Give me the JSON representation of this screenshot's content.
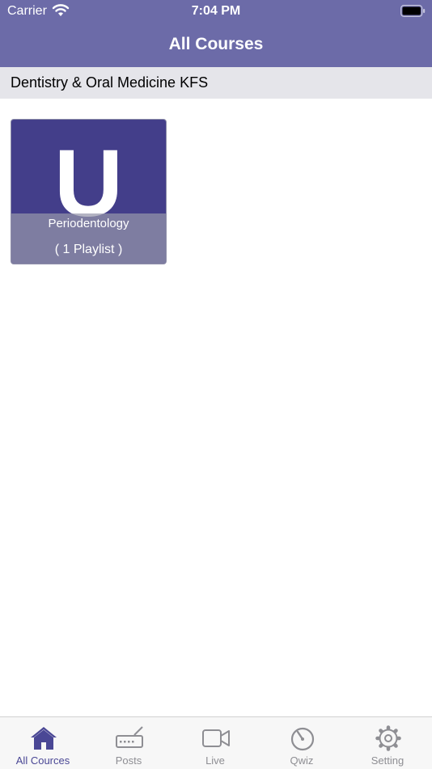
{
  "status_bar": {
    "carrier": "Carrier",
    "time": "7:04 PM"
  },
  "nav": {
    "title": "All Courses"
  },
  "section": {
    "title": "Dentistry & Oral Medicine KFS"
  },
  "courses": [
    {
      "letter": "U",
      "name": "Periodentology",
      "playlists": "( 1 Playlist )"
    }
  ],
  "tabs": [
    {
      "label": "All Cources",
      "icon": "home-icon",
      "active": true
    },
    {
      "label": "Posts",
      "icon": "keyboard-icon",
      "active": false
    },
    {
      "label": "Live",
      "icon": "video-camera-icon",
      "active": false
    },
    {
      "label": "Qwiz",
      "icon": "gauge-icon",
      "active": false
    },
    {
      "label": "Setting",
      "icon": "gear-icon",
      "active": false
    }
  ],
  "colors": {
    "header": "#6c6ba8",
    "card": "#433e8a",
    "active_tab": "#4a4795",
    "inactive_tab": "#8e8e93"
  }
}
